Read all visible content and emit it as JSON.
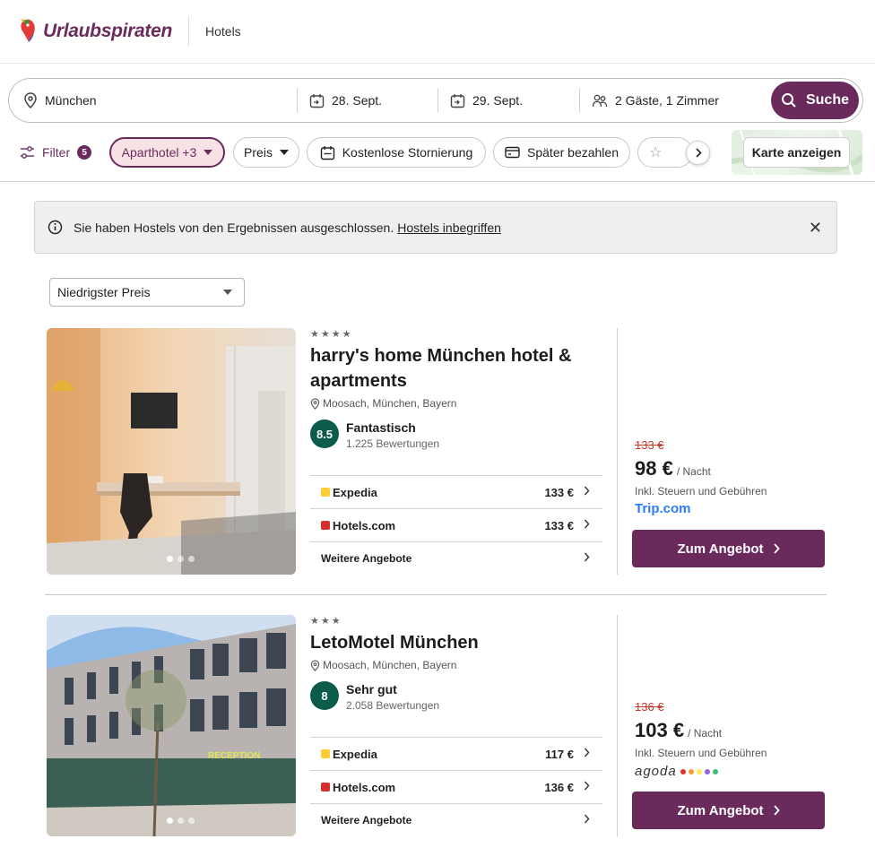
{
  "header": {
    "logo_text": "Urlaubspiraten",
    "nav_label": "Hotels"
  },
  "search": {
    "destination": "München",
    "checkin": "28. Sept.",
    "checkout": "29. Sept.",
    "guests": "2 Gäste, 1 Zimmer",
    "button_label": "Suche"
  },
  "filters": {
    "filter_label": "Filter",
    "filter_count": "5",
    "chips": [
      "Aparthotel +3",
      "Preis",
      "Kostenlose Stornierung",
      "Später bezahlen"
    ],
    "map_label": "Karte anzeigen"
  },
  "notice": {
    "text": "Sie haben Hostels von den Ergebnissen ausgeschlossen.",
    "link": "Hostels inbegriffen"
  },
  "sort": {
    "selected": "Niedrigster Preis"
  },
  "hotels": [
    {
      "stars": "★★★★",
      "name": "harry's home München hotel & apartments",
      "location": "Moosach, München, Bayern",
      "score": "8.5",
      "rating_word": "Fantastisch",
      "reviews": "1.225 Bewertungen",
      "offers": [
        {
          "provider": "Expedia",
          "price": "133 €"
        },
        {
          "provider": "Hotels.com",
          "price": "133 €"
        }
      ],
      "more_offers": "Weitere Angebote",
      "old_price": "133 €",
      "price": "98 €",
      "per_night": "/ Nacht",
      "taxes": "Inkl. Steuern und Gebühren",
      "partner": "Trip.com",
      "cta": "Zum Angebot"
    },
    {
      "stars": "★★★",
      "name": "LetoMotel München",
      "location": "Moosach, München, Bayern",
      "score": "8",
      "rating_word": "Sehr gut",
      "reviews": "2.058 Bewertungen",
      "offers": [
        {
          "provider": "Expedia",
          "price": "117 €"
        },
        {
          "provider": "Hotels.com",
          "price": "136 €"
        }
      ],
      "more_offers": "Weitere Angebote",
      "old_price": "136 €",
      "price": "103 €",
      "per_night": "/ Nacht",
      "taxes": "Inkl. Steuern und Gebühren",
      "partner": "agoda",
      "cta": "Zum Angebot"
    }
  ],
  "colors": {
    "brand": "#6b2a5c",
    "score_bg": "#0c5c4c",
    "strike_red": "#c0392b",
    "trip_blue": "#287dfa"
  },
  "image_photo_sign": "RECEPTION"
}
